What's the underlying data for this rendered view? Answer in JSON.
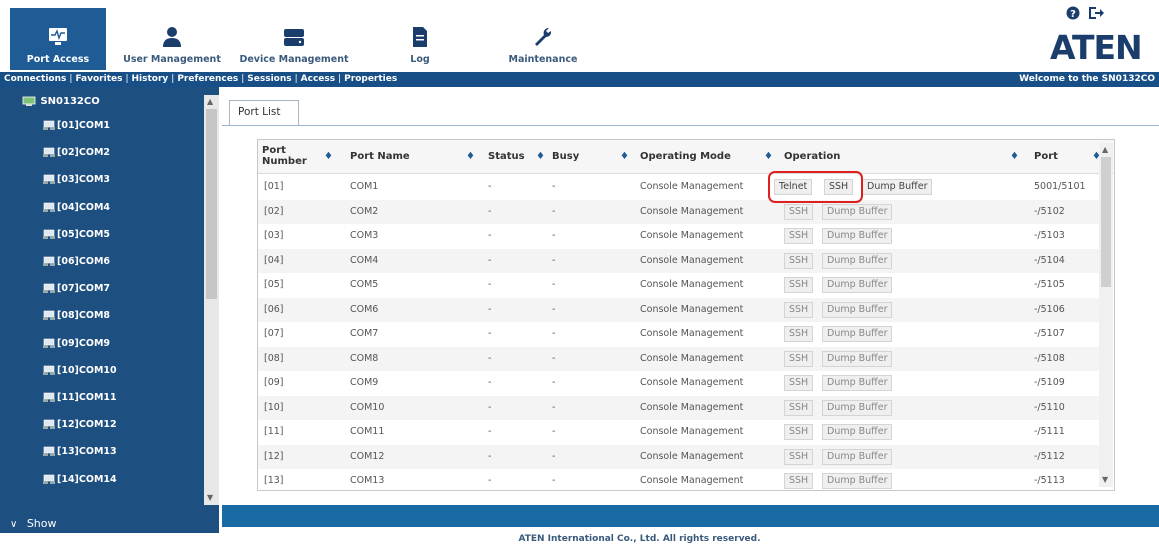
{
  "nav": {
    "items": [
      {
        "label": "Port Access",
        "icon": "monitor-icon"
      },
      {
        "label": "User Management",
        "icon": "user-icon"
      },
      {
        "label": "Device Management",
        "icon": "server-icon"
      },
      {
        "label": "Log",
        "icon": "document-icon"
      },
      {
        "label": "Maintenance",
        "icon": "wrench-icon"
      }
    ],
    "active_color": "#1f5b95"
  },
  "header_icons": {
    "help": "help-icon",
    "logout": "logout-icon"
  },
  "brand": {
    "logo": "ATEN"
  },
  "submenu": {
    "items": [
      "Connections",
      "Favorites",
      "History",
      "Preferences",
      "Sessions",
      "Access",
      "Properties"
    ],
    "separator": "|",
    "welcome": "Welcome to the SN0132CO"
  },
  "sidebar": {
    "root": "SN0132CO",
    "items": [
      "[01]COM1",
      "[02]COM2",
      "[03]COM3",
      "[04]COM4",
      "[05]COM5",
      "[06]COM6",
      "[07]COM7",
      "[08]COM8",
      "[09]COM9",
      "[10]COM10",
      "[11]COM11",
      "[12]COM12",
      "[13]COM13",
      "[14]COM14"
    ],
    "show_label": "Show"
  },
  "tab": {
    "label": "Port List"
  },
  "table": {
    "headers": {
      "port_number_l1": "Port",
      "port_number_l2": "Number",
      "port_name": "Port Name",
      "status": "Status",
      "busy": "Busy",
      "operating_mode": "Operating Mode",
      "operation": "Operation",
      "port": "Port"
    },
    "rows": [
      {
        "num": "[01]",
        "name": "COM1",
        "status": "-",
        "busy": "-",
        "mode": "Console Management",
        "ops": [
          "Telnet",
          "SSH",
          "Dump Buffer"
        ],
        "port": "5001/5101"
      },
      {
        "num": "[02]",
        "name": "COM2",
        "status": "-",
        "busy": "-",
        "mode": "Console Management",
        "ops": [
          "SSH",
          "Dump Buffer"
        ],
        "port": "-/5102"
      },
      {
        "num": "[03]",
        "name": "COM3",
        "status": "-",
        "busy": "-",
        "mode": "Console Management",
        "ops": [
          "SSH",
          "Dump Buffer"
        ],
        "port": "-/5103"
      },
      {
        "num": "[04]",
        "name": "COM4",
        "status": "-",
        "busy": "-",
        "mode": "Console Management",
        "ops": [
          "SSH",
          "Dump Buffer"
        ],
        "port": "-/5104"
      },
      {
        "num": "[05]",
        "name": "COM5",
        "status": "-",
        "busy": "-",
        "mode": "Console Management",
        "ops": [
          "SSH",
          "Dump Buffer"
        ],
        "port": "-/5105"
      },
      {
        "num": "[06]",
        "name": "COM6",
        "status": "-",
        "busy": "-",
        "mode": "Console Management",
        "ops": [
          "SSH",
          "Dump Buffer"
        ],
        "port": "-/5106"
      },
      {
        "num": "[07]",
        "name": "COM7",
        "status": "-",
        "busy": "-",
        "mode": "Console Management",
        "ops": [
          "SSH",
          "Dump Buffer"
        ],
        "port": "-/5107"
      },
      {
        "num": "[08]",
        "name": "COM8",
        "status": "-",
        "busy": "-",
        "mode": "Console Management",
        "ops": [
          "SSH",
          "Dump Buffer"
        ],
        "port": "-/5108"
      },
      {
        "num": "[09]",
        "name": "COM9",
        "status": "-",
        "busy": "-",
        "mode": "Console Management",
        "ops": [
          "SSH",
          "Dump Buffer"
        ],
        "port": "-/5109"
      },
      {
        "num": "[10]",
        "name": "COM10",
        "status": "-",
        "busy": "-",
        "mode": "Console Management",
        "ops": [
          "SSH",
          "Dump Buffer"
        ],
        "port": "-/5110"
      },
      {
        "num": "[11]",
        "name": "COM11",
        "status": "-",
        "busy": "-",
        "mode": "Console Management",
        "ops": [
          "SSH",
          "Dump Buffer"
        ],
        "port": "-/5111"
      },
      {
        "num": "[12]",
        "name": "COM12",
        "status": "-",
        "busy": "-",
        "mode": "Console Management",
        "ops": [
          "SSH",
          "Dump Buffer"
        ],
        "port": "-/5112"
      },
      {
        "num": "[13]",
        "name": "COM13",
        "status": "-",
        "busy": "-",
        "mode": "Console Management",
        "ops": [
          "SSH",
          "Dump Buffer"
        ],
        "port": "-/5113"
      }
    ]
  },
  "footer": {
    "text": "ATEN International Co., Ltd. All rights reserved."
  },
  "colors": {
    "sidebar_bg": "#1d4f81",
    "submenu_bg": "#174f86",
    "bottom_band": "#1a6aa3",
    "highlight": "#e02020"
  }
}
